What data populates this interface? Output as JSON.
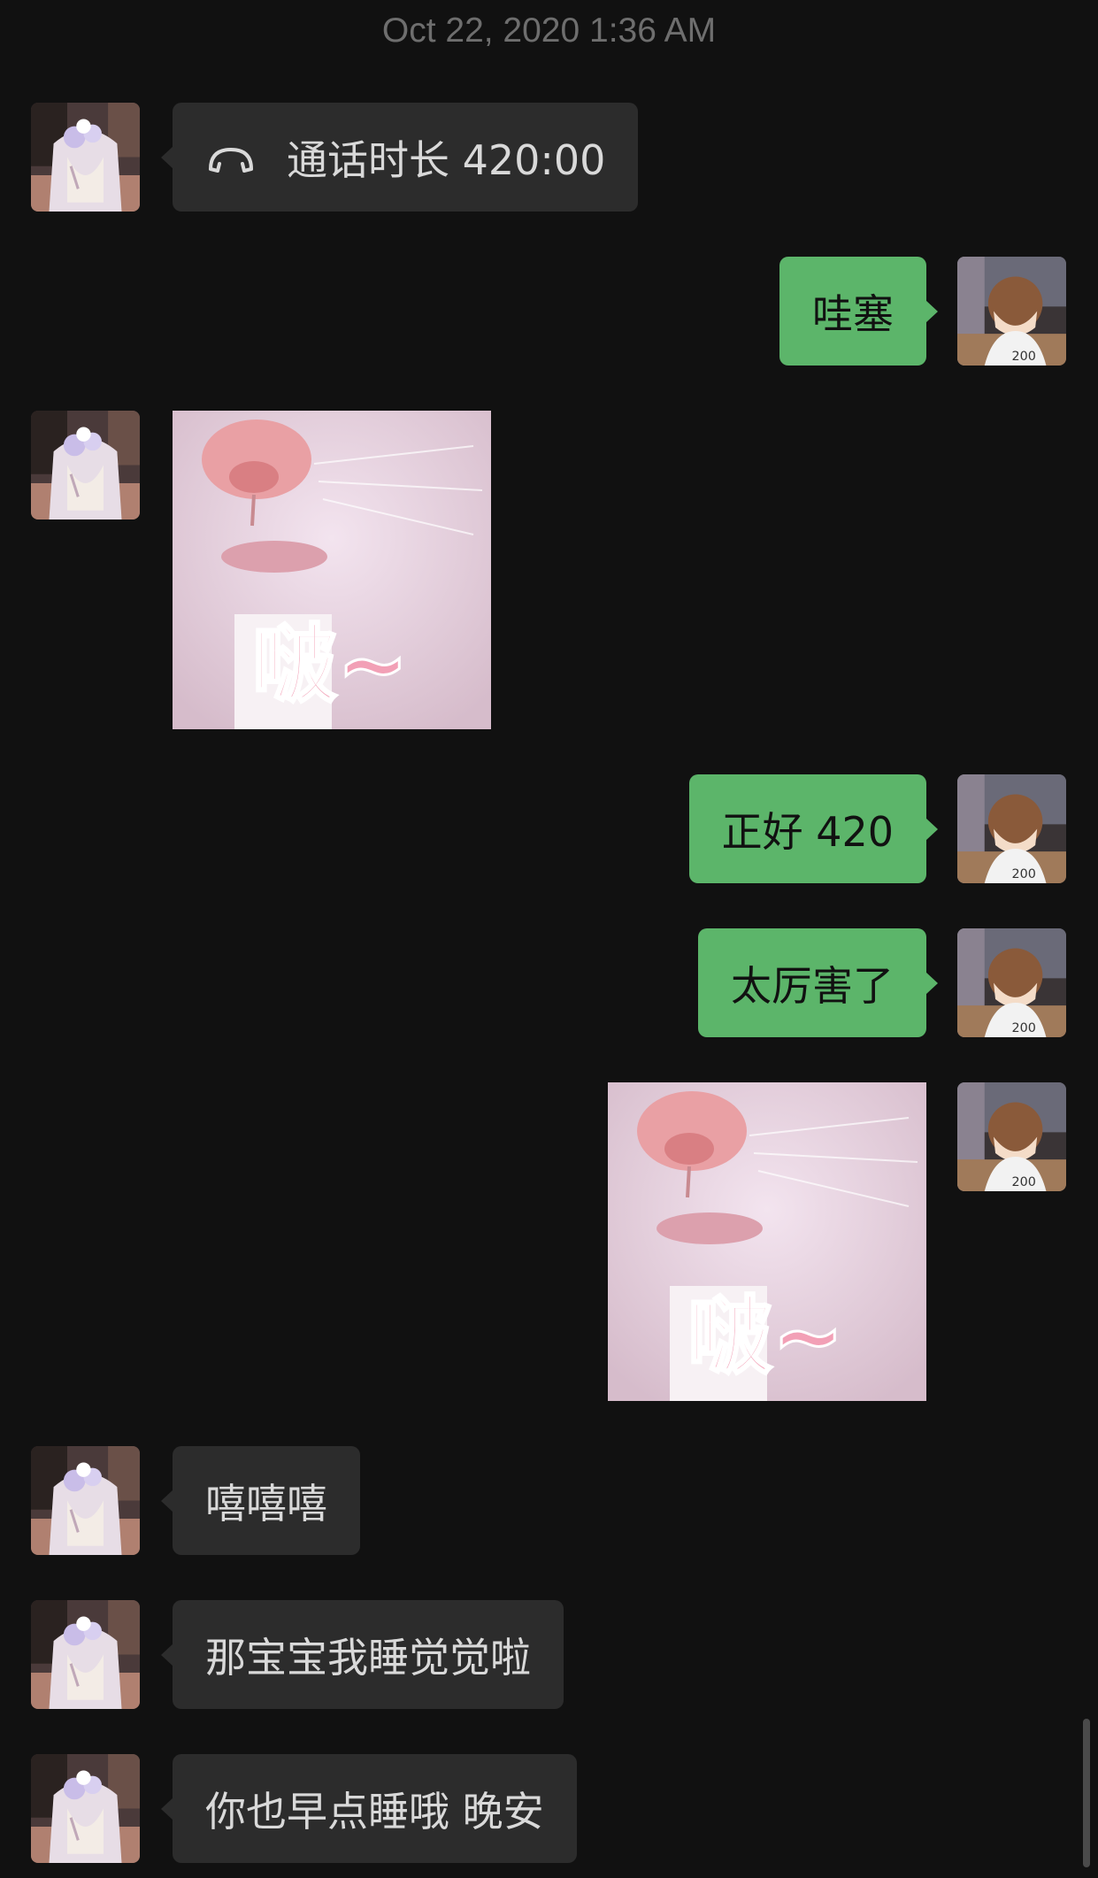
{
  "timestamp": "Oct 22, 2020 1:36 AM",
  "messages": [
    {
      "side": "in",
      "type": "call",
      "icon": "phone-hangup-icon",
      "text": "通话时长 420:00"
    },
    {
      "side": "out",
      "type": "text",
      "text": "哇塞"
    },
    {
      "side": "in",
      "type": "sticker",
      "sticker_text": "啵~"
    },
    {
      "side": "out",
      "type": "text",
      "text": "正好 420"
    },
    {
      "side": "out",
      "type": "text",
      "text": "太厉害了"
    },
    {
      "side": "out",
      "type": "sticker",
      "sticker_text": "啵~"
    },
    {
      "side": "in",
      "type": "text",
      "text": "嘻嘻嘻"
    },
    {
      "side": "in",
      "type": "text",
      "text": "那宝宝我睡觉觉啦"
    },
    {
      "side": "in",
      "type": "text",
      "text": "你也早点睡哦 晚安"
    }
  ],
  "colors": {
    "background": "#111111",
    "incoming_bubble": "#2c2c2c",
    "outgoing_bubble": "#5cb56a"
  }
}
